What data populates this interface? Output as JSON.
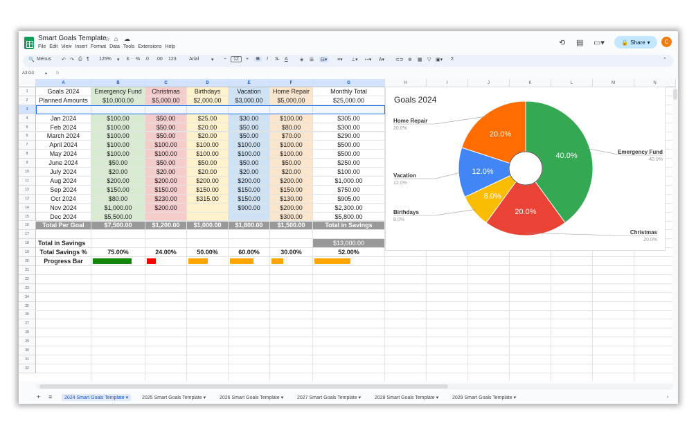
{
  "title": "Smart Goals Template",
  "menu": [
    "File",
    "Edit",
    "View",
    "Insert",
    "Format",
    "Data",
    "Tools",
    "Extensions",
    "Help"
  ],
  "share_label": "Share",
  "account_initial": "C",
  "toolbar": {
    "menus": "Menus",
    "zoom": "125%",
    "currency": "£",
    "percent": "%",
    "dec_dec": ".0",
    "inc_dec": ".00",
    "format_more": "123",
    "font": "Arial",
    "font_size": "12",
    "bold": "B",
    "italic": "I"
  },
  "name_box": "A3:G3",
  "fx": "fx",
  "col_headers": [
    "A",
    "B",
    "C",
    "D",
    "E",
    "F",
    "G",
    "H",
    "I",
    "J",
    "K",
    "L",
    "M",
    "N"
  ],
  "row_numbers": [
    "1",
    "2",
    "3",
    "4",
    "5",
    "6",
    "7",
    "8",
    "9",
    "10",
    "11",
    "12",
    "13",
    "14",
    "15",
    "16",
    "17",
    "18",
    "19",
    "20",
    "21",
    "22",
    "23",
    "24",
    "25",
    "26",
    "27",
    "28",
    "29",
    "30",
    "31",
    "32"
  ],
  "table": {
    "headers": [
      "Goals 2024",
      "Emergency Fund",
      "Christmas",
      "Birthdays",
      "Vacation",
      "Home Repair",
      "Monthly Total"
    ],
    "planned": [
      "Planned Amounts",
      "$10,000.00",
      "$5,000.00",
      "$2,000.00",
      "$3,000.00",
      "$5,000.00",
      "$25,000.00"
    ],
    "rows": [
      [
        "Jan 2024",
        "$100.00",
        "$50.00",
        "$25.00",
        "$30.00",
        "$100.00",
        "$305.00"
      ],
      [
        "Feb 2024",
        "$100.00",
        "$50.00",
        "$20.00",
        "$50.00",
        "$80.00",
        "$300.00"
      ],
      [
        "March 2024",
        "$100.00",
        "$50.00",
        "$20.00",
        "$50.00",
        "$70.00",
        "$290.00"
      ],
      [
        "April 2024",
        "$100.00",
        "$100.00",
        "$100.00",
        "$100.00",
        "$100.00",
        "$500.00"
      ],
      [
        "May 2024",
        "$100.00",
        "$100.00",
        "$100.00",
        "$100.00",
        "$100.00",
        "$500.00"
      ],
      [
        "June 2024",
        "$50.00",
        "$50.00",
        "$50.00",
        "$50.00",
        "$50.00",
        "$250.00"
      ],
      [
        "July 2024",
        "$20.00",
        "$20.00",
        "$20.00",
        "$20.00",
        "$20.00",
        "$100.00"
      ],
      [
        "Aug 2024",
        "$200.00",
        "$200.00",
        "$200.00",
        "$200.00",
        "$200.00",
        "$1,000.00"
      ],
      [
        "Sep 2024",
        "$150.00",
        "$150.00",
        "$150.00",
        "$150.00",
        "$150.00",
        "$750.00"
      ],
      [
        "Oct 2024",
        "$80.00",
        "$230.00",
        "$315.00",
        "$150.00",
        "$130.00",
        "$905.00"
      ],
      [
        "Nov 2024",
        "$1,000.00",
        "$200.00",
        "",
        "$900.00",
        "$200.00",
        "$2,300.00"
      ],
      [
        "Dec 2024",
        "$5,500.00",
        "",
        "",
        "",
        "$300.00",
        "$5,800.00"
      ]
    ],
    "totals": [
      "Total Per Goal",
      "$7,500.00",
      "$1,200.00",
      "$1,000.00",
      "$1,800.00",
      "$1,500.00",
      "Total in Savings"
    ],
    "total_in_savings_label": "Total in Savings",
    "total_in_savings_value": "$13,000.00",
    "total_pct_label": "Total Savings %",
    "pcts": [
      "75.00%",
      "24.00%",
      "50.00%",
      "60.00%",
      "30.00%",
      "52.00%"
    ],
    "progress_label": "Progress Bar",
    "progress": [
      0.75,
      0.24,
      0.5,
      0.6,
      0.3,
      0.52
    ],
    "progress_colors": [
      "#138808",
      "#ff0000",
      "#ffa500",
      "#ffa500",
      "#ffa500",
      "#ffa500"
    ],
    "column_colors": {
      "emergency": "#d9ead3",
      "christmas": "#f4cccc",
      "birthdays": "#fff2cc",
      "vacation": "#cfe2f3",
      "home_repair": "#fce5cd",
      "total_row": "#999999"
    }
  },
  "chart_data": {
    "type": "pie",
    "title": "Goals 2024",
    "slices": [
      {
        "label": "Emergency Fund",
        "value": 40.0,
        "pct": "40.0%",
        "color": "#34a853"
      },
      {
        "label": "Christmas",
        "value": 20.0,
        "pct": "20.0%",
        "color": "#ea4335"
      },
      {
        "label": "Birthdays",
        "value": 8.0,
        "pct": "8.0%",
        "color": "#fbbc04"
      },
      {
        "label": "Vacation",
        "value": 12.0,
        "pct": "12.0%",
        "color": "#4285f4"
      },
      {
        "label": "Home Repair",
        "value": 20.0,
        "pct": "20.0%",
        "color": "#ff6d01"
      }
    ],
    "donut": true
  },
  "sheet_tabs": [
    "2024 Smart Goals Template",
    "2025 Smart Goals Template",
    "2026 Smart Goals Template",
    "2027 Smart Goals Template",
    "2028 Smart Goals Template",
    "2029 Smart Goals Template"
  ]
}
